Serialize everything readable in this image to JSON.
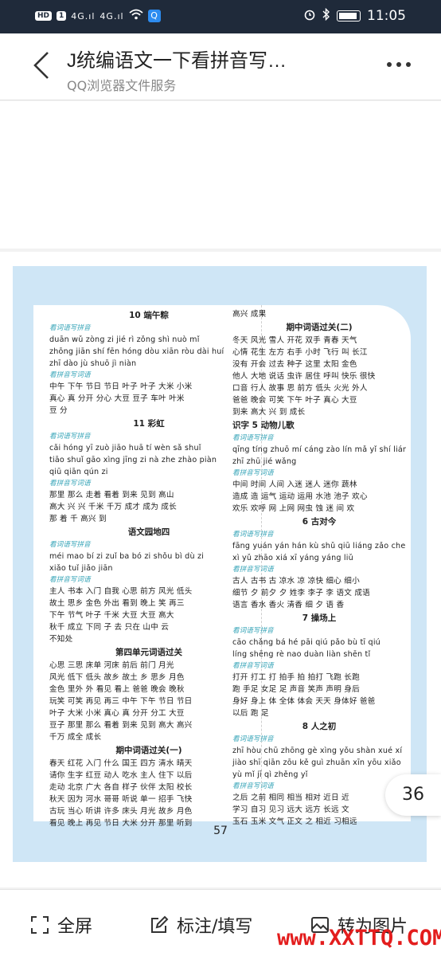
{
  "status": {
    "hd_label": "HD",
    "sim_label": "1",
    "sig1": "4G.ıl",
    "sig2": "4G.ıl",
    "qq_badge": "Q",
    "time": "11:05"
  },
  "header": {
    "title": "J统编语文一下看拼音写…",
    "subtitle": "QQ浏览器文件服务"
  },
  "page": {
    "left": [
      {
        "t": "sec",
        "v": "10  端午粽"
      },
      {
        "t": "sub",
        "v": "看词语写拼音"
      },
      {
        "t": "ln",
        "v": "duān wǔ   zòng zi   jié rì   zǒng shì   nuò mǐ"
      },
      {
        "t": "ln",
        "v": "zhōng jiān   shí fēn   hóng dòu   xiān ròu   dài huí"
      },
      {
        "t": "ln",
        "v": "zhī dào   jù shuō   jì niàn"
      },
      {
        "t": "sub",
        "v": "看拼音写词语"
      },
      {
        "t": "ln",
        "v": "中午  下午  节日  节日  叶子  叶子  大米  小米"
      },
      {
        "t": "ln",
        "v": "真心  真   分开  分心  大豆  豆子  车叶  叶米"
      },
      {
        "t": "ln",
        "v": "豆  分"
      },
      {
        "t": "sec",
        "v": "11  彩虹"
      },
      {
        "t": "sub",
        "v": "看词语写拼音"
      },
      {
        "t": "ln",
        "v": "cǎi hóng   yī zuò   jiāo huā   tí wèn   sǎ shuǐ"
      },
      {
        "t": "ln",
        "v": "tiāo shuǐ   gāo xìng   jīng zi   nà zhe   zhào piàn"
      },
      {
        "t": "ln",
        "v": "qiū qiān   qún zi"
      },
      {
        "t": "sub",
        "v": "看拼音写词语"
      },
      {
        "t": "ln",
        "v": "那里  那么  走着  看着  到来  见到  高山"
      },
      {
        "t": "ln",
        "v": "高大  兴  兴  千米  千万  成才  成为  成长"
      },
      {
        "t": "ln",
        "v": "那  着  千  高兴  到"
      },
      {
        "t": "sec",
        "v": "语文园地四"
      },
      {
        "t": "sub",
        "v": "看词语写拼音"
      },
      {
        "t": "ln",
        "v": "méi mao   bí zi   zuǐ ba   bó zi   shǒu bì   dù zi"
      },
      {
        "t": "ln",
        "v": "xiǎo tuǐ   jiǎo jiān"
      },
      {
        "t": "sub",
        "v": "看拼音写词语"
      },
      {
        "t": "ln",
        "v": "主人  书本  入门  自我  心思  前方  风光  低头"
      },
      {
        "t": "ln",
        "v": "故土  思乡  金色  外出  看到  晚上  笑  再三"
      },
      {
        "t": "ln",
        "v": "下午  节气  叶子  千米  大豆  大豆  高大"
      },
      {
        "t": "ln",
        "v": "秋千  成立  下同  子  去  只在  山中  云"
      },
      {
        "t": "ln",
        "v": "不知处"
      },
      {
        "t": "sec",
        "v": "第四单元词语过关"
      },
      {
        "t": "ln",
        "v": "心思  三思  床单  河床  前后  前门  月光"
      },
      {
        "t": "ln",
        "v": "风光  低下  低头  故乡  故土  乡  思乡  月色"
      },
      {
        "t": "ln",
        "v": "金色  里外  外  看见  看上  爸爸  晚会  晚秋"
      },
      {
        "t": "ln",
        "v": "玩笑  可笑  再见  再三  中午  下午  节日  节日"
      },
      {
        "t": "ln",
        "v": "叶子  大米  小米  真心  真  分开  分工  大豆"
      },
      {
        "t": "ln",
        "v": "豆子  那里  那么  看着  到来  见到  高大  高兴"
      },
      {
        "t": "ln",
        "v": "千万  成全  成长"
      },
      {
        "t": "sec",
        "v": "期中词语过关(一)"
      },
      {
        "t": "ln",
        "v": "春天  红花  入门  什么  国王  四方  清水  晴天"
      },
      {
        "t": "ln",
        "v": "请你  生字  红豆  动人  吃水  主人  住下  以后"
      },
      {
        "t": "ln",
        "v": "走动  北京  广大  各自  样子  伙伴  太阳  校长"
      },
      {
        "t": "ln",
        "v": "秋天  因为  河水  哥哥  听说  单一  招手  飞快"
      },
      {
        "t": "ln",
        "v": "古玩  当心  听讲  许多  床头  月光  故乡  月色"
      },
      {
        "t": "ln",
        "v": "看见  晚上  再见  节日  大米  分开  那里  听到"
      }
    ],
    "right": [
      {
        "t": "ln",
        "v": "高兴  成果"
      },
      {
        "t": "sec",
        "v": "期中词语过关(二)"
      },
      {
        "t": "ln",
        "v": "冬天  风光  雪人  开花  双手  青春  天气"
      },
      {
        "t": "ln",
        "v": "心情  花生  左方  右手  小时  飞行  叫  长江"
      },
      {
        "t": "ln",
        "v": "没有  开会  过去  种子  这里  太阳  金色"
      },
      {
        "t": "ln",
        "v": "他人  大地  说话  虫许  居住  呼叫  快乐  很快"
      },
      {
        "t": "ln",
        "v": "口音  行人  故事  思  前方  低头  火光  外人"
      },
      {
        "t": "ln",
        "v": "爸爸  晚会  可笑  下午  叶子  真心  大豆"
      },
      {
        "t": "ln",
        "v": "到来  高大  兴  到  成长"
      },
      {
        "t": "secl",
        "v": "识字      5  动物儿歌"
      },
      {
        "t": "sub",
        "v": "看词语写拼音"
      },
      {
        "t": "ln",
        "v": "qīng tíng  zhuō mí cáng  zào lín  mǎ yǐ  shí liáng"
      },
      {
        "t": "ln",
        "v": "zhī zhū   jié wǎng"
      },
      {
        "t": "sub",
        "v": "看拼音写词语"
      },
      {
        "t": "ln",
        "v": "中间  时间  人间  入迷  迷人  迷你  蔬林"
      },
      {
        "t": "ln",
        "v": "造成  造  运气  运动  运用  水池  池子  欢心"
      },
      {
        "t": "ln",
        "v": "欢乐  欢呼  网  上网  网虫  蚀  迷  间  欢"
      },
      {
        "t": "sec",
        "v": "6  古对今"
      },
      {
        "t": "sub",
        "v": "看词语写拼音"
      },
      {
        "t": "ln",
        "v": "fāng yuán  yán hán  kù shǔ  qiū liáng  zǎo chen"
      },
      {
        "t": "ln",
        "v": "xì yǔ   zhāo xiá   xī yáng   yáng liǔ"
      },
      {
        "t": "sub",
        "v": "看拼音写词语"
      },
      {
        "t": "ln",
        "v": "古人  古书  古  凉水  凉  凉快  细心  细小"
      },
      {
        "t": "ln",
        "v": "细节  夕  前夕  夕  姓李  李子  李  语文  成语"
      },
      {
        "t": "ln",
        "v": "语言  香水  香火  清香  细  夕  语  香"
      },
      {
        "t": "sec",
        "v": "7  操场上"
      },
      {
        "t": "sub",
        "v": "看词语写拼音"
      },
      {
        "t": "ln",
        "v": "cāo chǎng   bá hé   pāi qiú   pǎo bù   tī qiú"
      },
      {
        "t": "ln",
        "v": "líng shēng   rè nao   duàn liàn   shēn tǐ"
      },
      {
        "t": "sub",
        "v": "看拼音写词语"
      },
      {
        "t": "ln",
        "v": "打开  打工  打  拍手  拍  拍打  飞跑  长跑"
      },
      {
        "t": "ln",
        "v": "跑  手足  女足  足  声音  笑声  声明  身后"
      },
      {
        "t": "ln",
        "v": "身好  身上  体  全体  体会  天天  身体好  爸爸"
      },
      {
        "t": "ln",
        "v": "以后  跑  足"
      },
      {
        "t": "sec",
        "v": "8  人之初"
      },
      {
        "t": "sub",
        "v": "看词语写拼音"
      },
      {
        "t": "ln",
        "v": "zhī hòu   chū zhōng   gè xìng   yǒu shàn   xué xí"
      },
      {
        "t": "ln",
        "v": "jiào shī   qiān zōu   kě guì   zhuān xīn   yōu xiǎo"
      },
      {
        "t": "ln",
        "v": "yù mǐ   jī qì   zhěng yǐ"
      },
      {
        "t": "sub",
        "v": "看拼音写词语"
      },
      {
        "t": "ln",
        "v": "之后  之前  相同  相当  相对  近日  近"
      },
      {
        "t": "ln",
        "v": "学习  自习  见习  远大  远方  长远  文"
      },
      {
        "t": "ln",
        "v": "玉石  玉米  文气  正文  之  相近  习相远"
      }
    ],
    "page_number": "57"
  },
  "page_badge": "36",
  "bottom": {
    "fullscreen": "全屏",
    "annotate": "标注/填写",
    "to_image": "转为图片"
  },
  "watermark": "www.XXTTQ.COM",
  "colors": {
    "statusbar": "#1f2a3a",
    "doc_bg": "#cfe6f6",
    "sub_label": "#3aa6b9",
    "watermark": "#e31d1d"
  }
}
